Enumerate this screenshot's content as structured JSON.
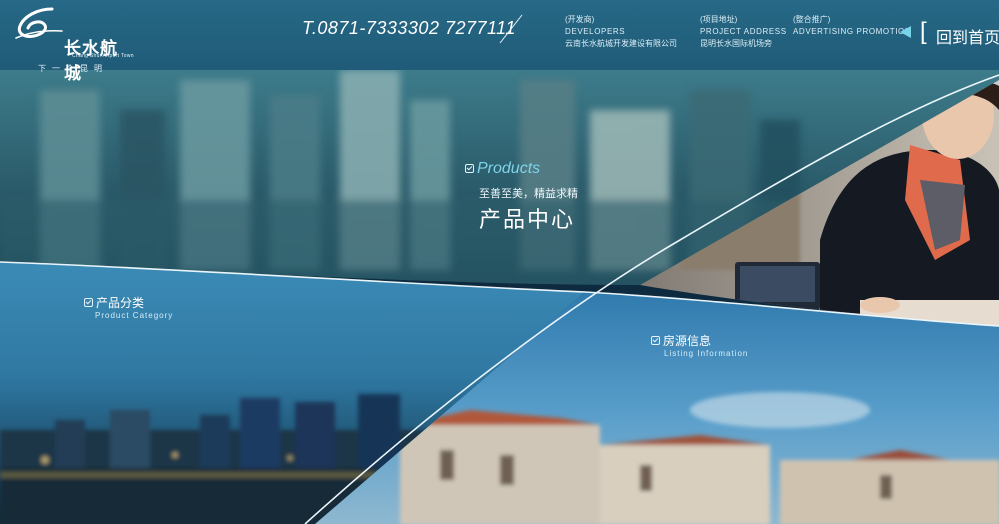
{
  "header": {
    "logo": {
      "brand": "长水航城",
      "english": "Chang Shui Airport Town",
      "slogan": "下一个昆明",
      "icon": "logo-6-swoosh"
    },
    "phone": "T.0871-7333302 7277111",
    "developer": {
      "cn_label": "(开发商)",
      "en_label": "DEVELOPERS",
      "value": "云南长水航城开发建设有限公司"
    },
    "project": {
      "cn_label": "(项目地址)",
      "en_label": "PROJECT ADDRESS",
      "value": "昆明长水国际机场旁"
    },
    "promotion": {
      "cn_label": "(整合推广)",
      "en_label": "ADVERTISING PROMOTION"
    },
    "home_link": {
      "bracket": "[",
      "label": "回到首页",
      "icon": "arrow-left-icon"
    }
  },
  "sections": {
    "products": {
      "en": "Products",
      "subtitle": "至善至美，精益求精",
      "title": "产品中心",
      "icon": "checkbox-icon"
    },
    "category": {
      "cn": "产品分类",
      "en": "Product Category",
      "icon": "checkbox-icon"
    },
    "listing": {
      "cn": "房源信息",
      "en": "Listing Information",
      "icon": "checkbox-icon"
    }
  },
  "colors": {
    "header": "#2a6e8c",
    "accent": "#7fd3ea",
    "sky": "#2f7aa6"
  }
}
